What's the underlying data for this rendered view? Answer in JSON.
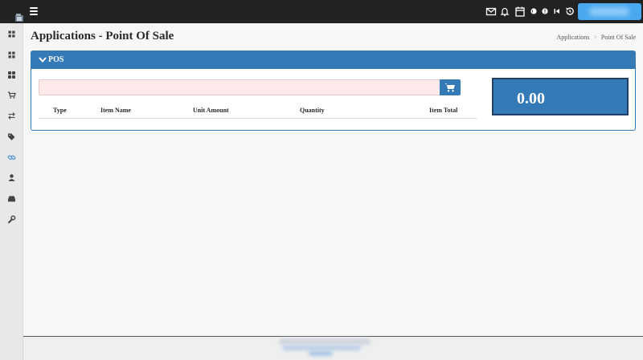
{
  "topbar": {
    "icons": [
      "envelope-icon",
      "bell-icon",
      "calendar-icon",
      "globe-icon",
      "info-icon",
      "step-backward-icon",
      "history-icon"
    ],
    "user_button_label": ""
  },
  "sidebar": {
    "icons": [
      "dashboard-icon",
      "dashboard-icon",
      "grid-icon",
      "shopping-cart-icon",
      "transfer-icon",
      "tags-icon",
      "link-icon",
      "user-icon",
      "hdd-icon",
      "wrench-icon"
    ],
    "active_index": 6
  },
  "page": {
    "title": "Applications - Point Of Sale",
    "breadcrumb": [
      "Applications",
      "Point Of Sale"
    ]
  },
  "panel": {
    "title": "POS",
    "search": {
      "value": "",
      "placeholder": ""
    },
    "table": {
      "columns": [
        "Type",
        "Item Name",
        "Unit Amount",
        "Quantity",
        "Item Total"
      ],
      "rows": []
    },
    "total": "0.00"
  },
  "colors": {
    "topbar": "#222222",
    "primary": "#337ab7",
    "user_button": "#4aa8f0",
    "search_bg": "#fde9e9",
    "active_sidebar_icon": "#4a90d9"
  }
}
